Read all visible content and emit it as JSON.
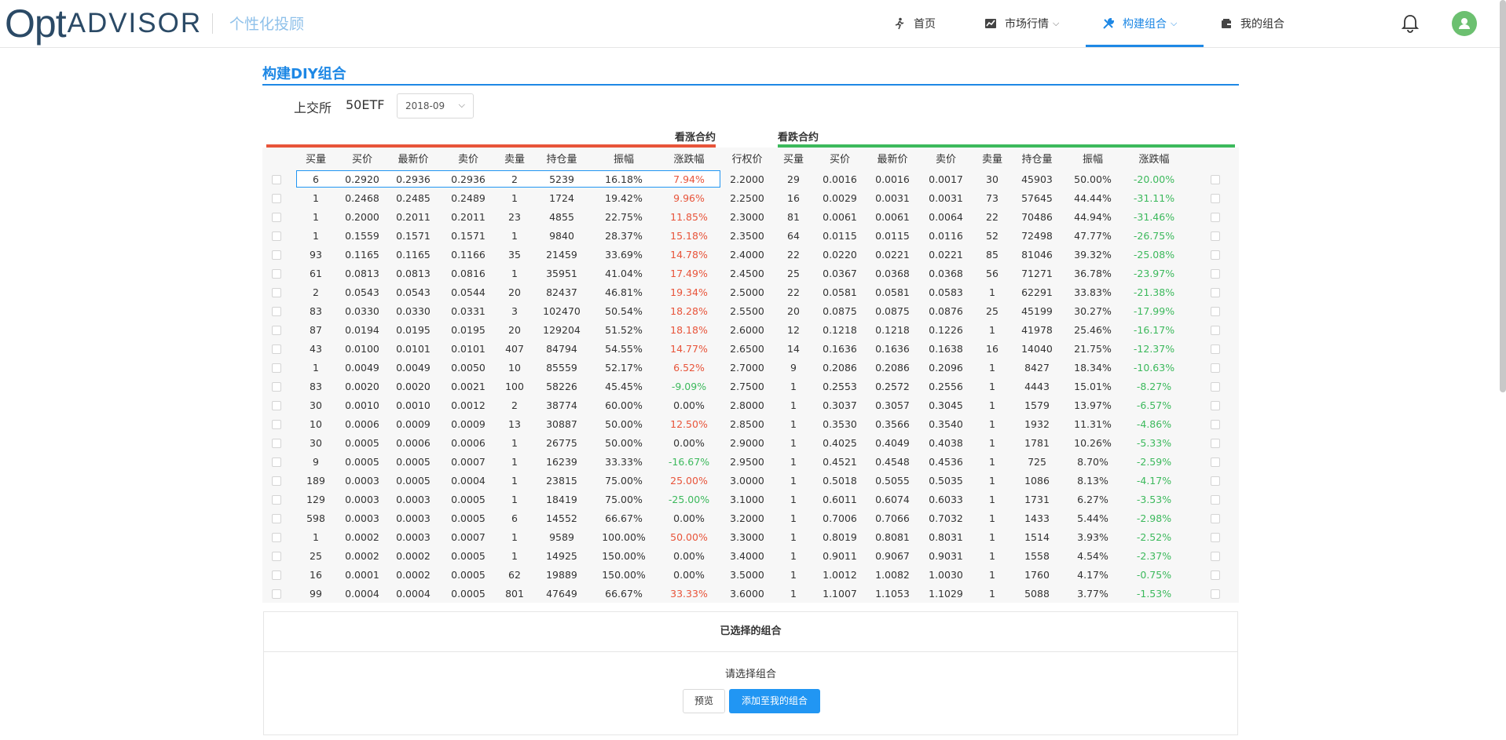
{
  "header": {
    "logo_main": "Opt",
    "logo_rest": "ADVISOR",
    "slogan": "个性化投顾",
    "nav": [
      {
        "label": "首页",
        "icon": "run-icon"
      },
      {
        "label": "市场行情",
        "icon": "chart-icon",
        "has_dropdown": true
      },
      {
        "label": "构建组合",
        "icon": "tools-icon",
        "has_dropdown": true,
        "active": true
      },
      {
        "label": "我的组合",
        "icon": "wallet-icon"
      }
    ]
  },
  "page": {
    "title": "构建DIY组合",
    "exchange": "上交所",
    "underlying": "50ETF",
    "month": "2018-09"
  },
  "table": {
    "call_title": "看涨合约",
    "put_title": "看跌合约",
    "call_headers": [
      "买量",
      "买价",
      "最新价",
      "卖价",
      "卖量",
      "持仓量",
      "振幅",
      "涨跌幅"
    ],
    "strike_header": "行权价",
    "put_headers": [
      "买量",
      "买价",
      "最新价",
      "卖价",
      "卖量",
      "持仓量",
      "振幅",
      "涨跌幅"
    ],
    "rows": [
      {
        "call": [
          "6",
          "0.2920",
          "0.2936",
          "0.2936",
          "2",
          "5239",
          "16.18%",
          "7.94%"
        ],
        "strike": "2.2000",
        "put": [
          "29",
          "0.0016",
          "0.0016",
          "0.0017",
          "30",
          "45903",
          "50.00%",
          "-20.00%"
        ]
      },
      {
        "call": [
          "1",
          "0.2468",
          "0.2485",
          "0.2489",
          "1",
          "1724",
          "19.42%",
          "9.96%"
        ],
        "strike": "2.2500",
        "put": [
          "16",
          "0.0029",
          "0.0031",
          "0.0031",
          "73",
          "57645",
          "44.44%",
          "-31.11%"
        ]
      },
      {
        "call": [
          "1",
          "0.2000",
          "0.2011",
          "0.2011",
          "23",
          "4855",
          "22.75%",
          "11.85%"
        ],
        "strike": "2.3000",
        "put": [
          "81",
          "0.0061",
          "0.0061",
          "0.0064",
          "22",
          "70486",
          "44.94%",
          "-31.46%"
        ]
      },
      {
        "call": [
          "1",
          "0.1559",
          "0.1571",
          "0.1571",
          "1",
          "9840",
          "28.37%",
          "15.18%"
        ],
        "strike": "2.3500",
        "put": [
          "64",
          "0.0115",
          "0.0115",
          "0.0116",
          "52",
          "72498",
          "47.77%",
          "-26.75%"
        ]
      },
      {
        "call": [
          "93",
          "0.1165",
          "0.1165",
          "0.1166",
          "35",
          "21459",
          "33.69%",
          "14.78%"
        ],
        "strike": "2.4000",
        "put": [
          "22",
          "0.0220",
          "0.0221",
          "0.0221",
          "85",
          "81046",
          "39.32%",
          "-25.08%"
        ]
      },
      {
        "call": [
          "61",
          "0.0813",
          "0.0813",
          "0.0816",
          "1",
          "35951",
          "41.04%",
          "17.49%"
        ],
        "strike": "2.4500",
        "put": [
          "25",
          "0.0367",
          "0.0368",
          "0.0368",
          "56",
          "71271",
          "36.78%",
          "-23.97%"
        ]
      },
      {
        "call": [
          "2",
          "0.0543",
          "0.0543",
          "0.0544",
          "20",
          "82437",
          "46.81%",
          "19.34%"
        ],
        "strike": "2.5000",
        "put": [
          "22",
          "0.0581",
          "0.0581",
          "0.0583",
          "1",
          "62291",
          "33.83%",
          "-21.38%"
        ]
      },
      {
        "call": [
          "83",
          "0.0330",
          "0.0330",
          "0.0331",
          "3",
          "102470",
          "50.54%",
          "18.28%"
        ],
        "strike": "2.5500",
        "put": [
          "20",
          "0.0875",
          "0.0875",
          "0.0876",
          "25",
          "45199",
          "30.27%",
          "-17.99%"
        ]
      },
      {
        "call": [
          "87",
          "0.0194",
          "0.0195",
          "0.0195",
          "20",
          "129204",
          "51.52%",
          "18.18%"
        ],
        "strike": "2.6000",
        "put": [
          "12",
          "0.1218",
          "0.1218",
          "0.1226",
          "1",
          "41978",
          "25.46%",
          "-16.17%"
        ]
      },
      {
        "call": [
          "43",
          "0.0100",
          "0.0101",
          "0.0101",
          "407",
          "84794",
          "54.55%",
          "14.77%"
        ],
        "strike": "2.6500",
        "put": [
          "14",
          "0.1636",
          "0.1636",
          "0.1638",
          "16",
          "14040",
          "21.75%",
          "-12.37%"
        ]
      },
      {
        "call": [
          "1",
          "0.0049",
          "0.0049",
          "0.0050",
          "10",
          "85559",
          "52.17%",
          "6.52%"
        ],
        "strike": "2.7000",
        "put": [
          "9",
          "0.2086",
          "0.2086",
          "0.2096",
          "1",
          "8427",
          "18.34%",
          "-10.63%"
        ]
      },
      {
        "call": [
          "83",
          "0.0020",
          "0.0020",
          "0.0021",
          "100",
          "58226",
          "45.45%",
          "-9.09%"
        ],
        "strike": "2.7500",
        "put": [
          "1",
          "0.2553",
          "0.2572",
          "0.2556",
          "1",
          "4443",
          "15.01%",
          "-8.27%"
        ]
      },
      {
        "call": [
          "30",
          "0.0010",
          "0.0010",
          "0.0012",
          "2",
          "38774",
          "60.00%",
          "0.00%"
        ],
        "strike": "2.8000",
        "put": [
          "1",
          "0.3037",
          "0.3057",
          "0.3045",
          "1",
          "1579",
          "13.97%",
          "-6.57%"
        ]
      },
      {
        "call": [
          "10",
          "0.0006",
          "0.0009",
          "0.0009",
          "13",
          "30887",
          "50.00%",
          "12.50%"
        ],
        "strike": "2.8500",
        "put": [
          "1",
          "0.3530",
          "0.3566",
          "0.3540",
          "1",
          "1932",
          "11.31%",
          "-4.86%"
        ]
      },
      {
        "call": [
          "30",
          "0.0005",
          "0.0006",
          "0.0006",
          "1",
          "26775",
          "50.00%",
          "0.00%"
        ],
        "strike": "2.9000",
        "put": [
          "1",
          "0.4025",
          "0.4049",
          "0.4038",
          "1",
          "1781",
          "10.26%",
          "-5.33%"
        ]
      },
      {
        "call": [
          "9",
          "0.0005",
          "0.0005",
          "0.0007",
          "1",
          "16239",
          "33.33%",
          "-16.67%"
        ],
        "strike": "2.9500",
        "put": [
          "1",
          "0.4521",
          "0.4548",
          "0.4536",
          "1",
          "725",
          "8.70%",
          "-2.59%"
        ]
      },
      {
        "call": [
          "189",
          "0.0003",
          "0.0005",
          "0.0004",
          "1",
          "23815",
          "75.00%",
          "25.00%"
        ],
        "strike": "3.0000",
        "put": [
          "1",
          "0.5018",
          "0.5055",
          "0.5035",
          "1",
          "1086",
          "8.13%",
          "-4.17%"
        ]
      },
      {
        "call": [
          "129",
          "0.0003",
          "0.0003",
          "0.0005",
          "1",
          "18419",
          "75.00%",
          "-25.00%"
        ],
        "strike": "3.1000",
        "put": [
          "1",
          "0.6011",
          "0.6074",
          "0.6033",
          "1",
          "1731",
          "6.27%",
          "-3.53%"
        ]
      },
      {
        "call": [
          "598",
          "0.0003",
          "0.0003",
          "0.0005",
          "6",
          "14552",
          "66.67%",
          "0.00%"
        ],
        "strike": "3.2000",
        "put": [
          "1",
          "0.7006",
          "0.7066",
          "0.7032",
          "1",
          "1433",
          "5.44%",
          "-2.98%"
        ]
      },
      {
        "call": [
          "1",
          "0.0002",
          "0.0003",
          "0.0007",
          "1",
          "9589",
          "100.00%",
          "50.00%"
        ],
        "strike": "3.3000",
        "put": [
          "1",
          "0.8019",
          "0.8081",
          "0.8031",
          "1",
          "1514",
          "3.93%",
          "-2.52%"
        ]
      },
      {
        "call": [
          "25",
          "0.0002",
          "0.0002",
          "0.0005",
          "1",
          "14925",
          "150.00%",
          "0.00%"
        ],
        "strike": "3.4000",
        "put": [
          "1",
          "0.9011",
          "0.9067",
          "0.9031",
          "1",
          "1558",
          "4.54%",
          "-2.37%"
        ]
      },
      {
        "call": [
          "16",
          "0.0001",
          "0.0002",
          "0.0005",
          "62",
          "19889",
          "150.00%",
          "0.00%"
        ],
        "strike": "3.5000",
        "put": [
          "1",
          "1.0012",
          "1.0082",
          "1.0030",
          "1",
          "1760",
          "4.17%",
          "-0.75%"
        ]
      },
      {
        "call": [
          "99",
          "0.0004",
          "0.0004",
          "0.0005",
          "801",
          "47649",
          "66.67%",
          "33.33%"
        ],
        "strike": "3.6000",
        "put": [
          "1",
          "1.1007",
          "1.1053",
          "1.1029",
          "1",
          "5088",
          "3.77%",
          "-1.53%"
        ]
      }
    ]
  },
  "selection": {
    "title": "已选择的组合",
    "empty_text": "请选择组合",
    "preview_label": "预览",
    "add_label": "添加至我的组合"
  },
  "colors": {
    "accent": "#1e88e5",
    "up": "#e8543a",
    "down": "#3cb95c"
  }
}
